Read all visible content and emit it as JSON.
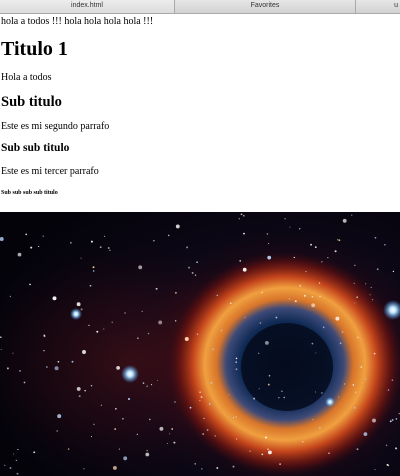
{
  "tabs": [
    {
      "label": "index.html",
      "active": true
    },
    {
      "label": "Favorites",
      "active": false
    },
    {
      "label": "u",
      "active": false
    }
  ],
  "page": {
    "top_line": "hola a todos !!! hola hola hola hola !!!",
    "title": "Titulo 1",
    "paragraph1": "Hola a todos",
    "subtitle": "Sub titulo",
    "paragraph2": "Este es mi segundo parrafo",
    "subsubtitle": "Sub sub titulo",
    "paragraph3": "Este es mi tercer parrafo",
    "small_heading": "Sub sub sub sub titulo"
  }
}
